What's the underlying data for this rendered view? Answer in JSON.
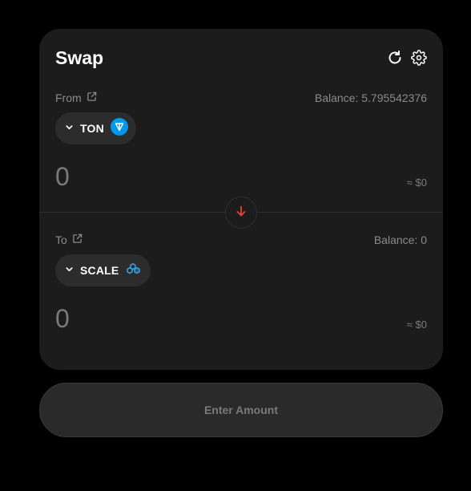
{
  "swap": {
    "title": "Swap",
    "from": {
      "label": "From",
      "balance": "Balance: 5.795542376",
      "token": "TON",
      "amount": "0",
      "usd": "≈ $0"
    },
    "to": {
      "label": "To",
      "balance": "Balance: 0",
      "token": "SCALE",
      "amount": "0",
      "usd": "≈ $0"
    }
  },
  "action_button": "Enter Amount",
  "colors": {
    "background": "#000000",
    "card": "#1c1c1c",
    "token_chip": "#2c2c2c",
    "arrow_accent": "#e0443a",
    "ton_blue": "#0098ea",
    "scale_blue": "#3aa0e8"
  },
  "icons": [
    "refresh-icon",
    "settings-gear-icon",
    "external-link-icon",
    "chevron-down-icon",
    "ton-token-icon",
    "scale-token-icon",
    "arrow-down-icon"
  ]
}
